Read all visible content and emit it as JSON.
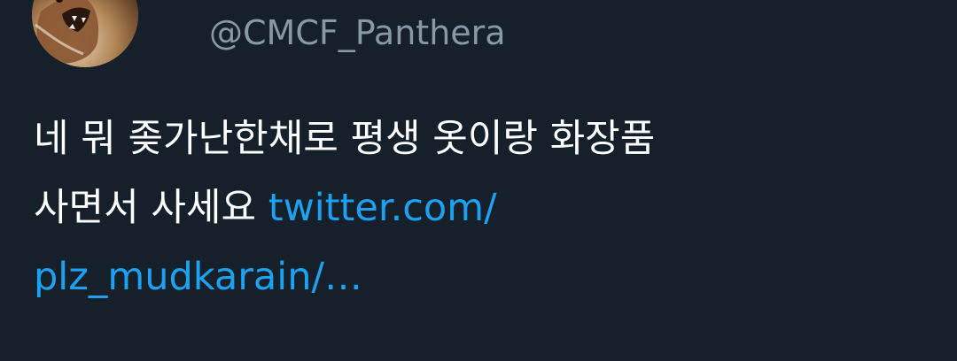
{
  "tweet": {
    "handle": "@CMCF_Panthera",
    "avatar_icon": "panther-avatar-icon",
    "text_line_1": "네 뭐 좆가난한채로 평생 옷이랑 화장품",
    "text_line_2_prefix": "사면서 사세요 ",
    "link_part_1": "twitter.com/",
    "link_part_2": "plz_mudkarain/…"
  },
  "colors": {
    "background": "#15202b",
    "text": "#ffffff",
    "handle": "#8899a6",
    "link": "#1da1f2"
  }
}
